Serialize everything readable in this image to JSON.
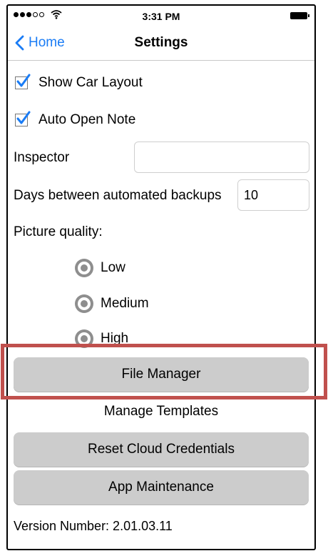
{
  "status_bar": {
    "time": "3:31 PM"
  },
  "nav": {
    "back_label": "Home",
    "title": "Settings"
  },
  "settings": {
    "show_car_layout": {
      "label": "Show Car Layout",
      "checked": true
    },
    "auto_open_note": {
      "label": "Auto Open Note",
      "checked": true
    },
    "inspector": {
      "label": "Inspector",
      "value": ""
    },
    "backups": {
      "label": "Days between automated backups",
      "value": "10"
    },
    "picture_quality": {
      "label": "Picture quality:",
      "options": [
        "Low",
        "Medium",
        "High"
      ]
    }
  },
  "buttons": {
    "file_manager": "File Manager",
    "manage_templates": "Manage Templates",
    "reset_cloud": "Reset Cloud Credentials",
    "app_maintenance": "App Maintenance"
  },
  "version": "Version Number: 2.01.03.11",
  "colors": {
    "accent": "#1a7cf5",
    "button_bg": "#cccccc",
    "highlight": "#c0504d"
  }
}
